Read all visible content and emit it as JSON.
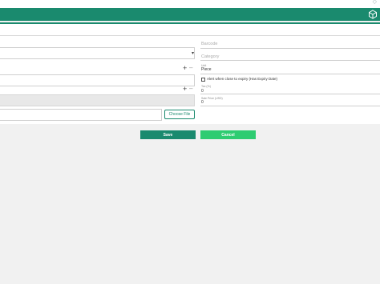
{
  "header": {
    "icon": "cube-icon"
  },
  "form": {
    "barcode_placeholder": "Barcode",
    "category_placeholder": "Category",
    "unit_label": "Unit",
    "unit_value": "Piece",
    "alert_label": "Alert when close to expiry (Has Expiry Date)",
    "tax_label": "Tax (%)",
    "tax_value": "0",
    "sale_price_label": "Sale Price (USD)",
    "sale_price_value": "0",
    "choose_file_label": "Choose File"
  },
  "actions": {
    "save_label": "Save",
    "cancel_label": "Cancel"
  },
  "colors": {
    "brand": "#1a8a6e",
    "cancel": "#2ecc71"
  }
}
